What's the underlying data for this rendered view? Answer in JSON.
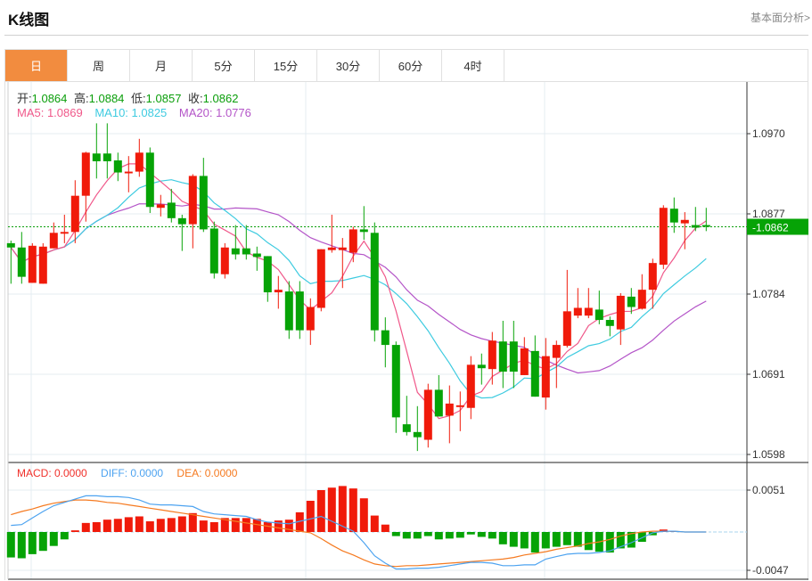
{
  "header": {
    "title": "K线图",
    "fundamental_link": "基本面分析>"
  },
  "tabs": [
    {
      "label": "日",
      "active": true
    },
    {
      "label": "周"
    },
    {
      "label": "月"
    },
    {
      "label": "5分"
    },
    {
      "label": "15分"
    },
    {
      "label": "30分"
    },
    {
      "label": "60分"
    },
    {
      "label": "4时"
    }
  ],
  "ohlc_legend": {
    "open_label": "开:",
    "open": "1.0864",
    "high_label": "高:",
    "high": "1.0884",
    "low_label": "低:",
    "low": "1.0857",
    "close_label": "收:",
    "close": "1.0862"
  },
  "ma_legend": {
    "ma5": "MA5: 1.0869",
    "ma10": "MA10: 1.0825",
    "ma20": "MA20: 1.0776"
  },
  "macd_legend": {
    "macd": "MACD: 0.0000",
    "diff": "DIFF: 0.0000",
    "dea": "DEA: 0.0000"
  },
  "colors": {
    "up": "#f01a0a",
    "down": "#06a306",
    "ma5": "#f0588a",
    "ma10": "#3ecbe0",
    "ma20": "#b455c8",
    "diff": "#4da3f0",
    "dea": "#f57a20",
    "accent": "#f28c3f"
  },
  "chart_data": {
    "type": "candlestick",
    "y_ticks": [
      "1.0970",
      "1.0877",
      "1.0784",
      "1.0691",
      "1.0598"
    ],
    "last_price": "1.0862",
    "macd_ticks": [
      "0.0051",
      "-0.0047"
    ],
    "candles": [
      [
        1.0843,
        1.0846,
        1.0796,
        1.0838
      ],
      [
        1.0838,
        1.0856,
        1.0796,
        1.0804
      ],
      [
        1.0797,
        1.0843,
        1.0797,
        1.084
      ],
      [
        1.0796,
        1.0843,
        1.0796,
        1.0839
      ],
      [
        1.0837,
        1.0867,
        1.0837,
        1.0855
      ],
      [
        1.0854,
        1.0876,
        1.0843,
        1.0856
      ],
      [
        1.0856,
        1.0916,
        1.0843,
        1.0898
      ],
      [
        1.0898,
        1.0949,
        1.0868,
        1.0948
      ],
      [
        1.0947,
        1.0982,
        1.0918,
        1.0938
      ],
      [
        1.0947,
        1.0982,
        1.0918,
        1.0938
      ],
      [
        1.0939,
        1.0948,
        1.0915,
        1.0925
      ],
      [
        1.0924,
        1.0944,
        1.0902,
        1.0926
      ],
      [
        1.0926,
        1.0964,
        1.092,
        1.0948
      ],
      [
        1.0948,
        1.0954,
        1.0878,
        1.0885
      ],
      [
        1.0884,
        1.0899,
        1.0874,
        1.0888
      ],
      [
        1.089,
        1.0906,
        1.0867,
        1.0872
      ],
      [
        1.0872,
        1.0876,
        1.0834,
        1.0865
      ],
      [
        1.0865,
        1.0923,
        1.0837,
        1.0921
      ],
      [
        1.0921,
        1.0942,
        1.0856,
        1.0859
      ],
      [
        1.086,
        1.0868,
        1.0802,
        1.0808
      ],
      [
        1.0807,
        1.0843,
        1.0802,
        1.0838
      ],
      [
        1.0837,
        1.0864,
        1.0824,
        1.083
      ],
      [
        1.0837,
        1.0864,
        1.0824,
        1.083
      ],
      [
        1.0831,
        1.0839,
        1.0811,
        1.0827
      ],
      [
        1.0828,
        1.0828,
        1.0775,
        1.0786
      ],
      [
        1.0786,
        1.0805,
        1.0767,
        1.0789
      ],
      [
        1.0787,
        1.0799,
        1.0732,
        1.0742
      ],
      [
        1.0787,
        1.0799,
        1.0732,
        1.0742
      ],
      [
        1.0742,
        1.0779,
        1.0725,
        1.0769
      ],
      [
        1.0768,
        1.0836,
        1.0764,
        1.0836
      ],
      [
        1.0835,
        1.0876,
        1.0832,
        1.0838
      ],
      [
        1.0835,
        1.0849,
        1.0791,
        1.0838
      ],
      [
        1.0832,
        1.0862,
        1.0821,
        1.0859
      ],
      [
        1.0859,
        1.0886,
        1.0847,
        1.0856
      ],
      [
        1.0855,
        1.0867,
        1.0729,
        1.0742
      ],
      [
        1.0742,
        1.0757,
        1.0699,
        1.0725
      ],
      [
        1.0725,
        1.0729,
        1.0623,
        1.0641
      ],
      [
        1.0633,
        1.0666,
        1.062,
        1.0624
      ],
      [
        1.0624,
        1.0654,
        1.0602,
        1.0618
      ],
      [
        1.0615,
        1.068,
        1.0606,
        1.0673
      ],
      [
        1.0673,
        1.069,
        1.0642,
        1.0642
      ],
      [
        1.0643,
        1.0678,
        1.0611,
        1.0657
      ],
      [
        1.0653,
        1.0671,
        1.0625,
        1.0655
      ],
      [
        1.0652,
        1.0712,
        1.0639,
        1.0702
      ],
      [
        1.0702,
        1.0715,
        1.0679,
        1.0698
      ],
      [
        1.0697,
        1.074,
        1.0679,
        1.073
      ],
      [
        1.0729,
        1.0753,
        1.0675,
        1.0694
      ],
      [
        1.0729,
        1.0753,
        1.0675,
        1.0694
      ],
      [
        1.069,
        1.0734,
        1.069,
        1.0721
      ],
      [
        1.0718,
        1.0736,
        1.0665,
        1.0665
      ],
      [
        1.0664,
        1.0733,
        1.065,
        1.0712
      ],
      [
        1.071,
        1.073,
        1.0675,
        1.0725
      ],
      [
        1.0724,
        1.0812,
        1.0722,
        1.0764
      ],
      [
        1.0759,
        1.0791,
        1.0756,
        1.0768
      ],
      [
        1.0759,
        1.0791,
        1.0756,
        1.0768
      ],
      [
        1.0766,
        1.0788,
        1.0749,
        1.0754
      ],
      [
        1.0754,
        1.0758,
        1.0735,
        1.0747
      ],
      [
        1.0743,
        1.0785,
        1.0725,
        1.0782
      ],
      [
        1.0781,
        1.0791,
        1.0761,
        1.0769
      ],
      [
        1.0767,
        1.0807,
        1.0766,
        1.0789
      ],
      [
        1.0789,
        1.0825,
        1.0767,
        1.082
      ],
      [
        1.0818,
        1.0887,
        1.0813,
        1.0884
      ],
      [
        1.0883,
        1.0896,
        1.0855,
        1.0867
      ],
      [
        1.0866,
        1.0879,
        1.0836,
        1.087
      ],
      [
        1.0864,
        1.0885,
        1.0857,
        1.0861
      ],
      [
        1.0864,
        1.0884,
        1.0857,
        1.0862
      ]
    ],
    "macd_hist": [
      -0.0031,
      -0.0032,
      -0.0027,
      -0.0023,
      -0.0017,
      -0.0009,
      0.0002,
      0.0011,
      0.0012,
      0.0015,
      0.0016,
      0.0018,
      0.0019,
      0.0013,
      0.0016,
      0.0017,
      0.0019,
      0.0023,
      0.0014,
      0.0012,
      0.0017,
      0.0017,
      0.0017,
      0.0016,
      0.0012,
      0.0014,
      0.0015,
      0.0024,
      0.0038,
      0.0051,
      0.0054,
      0.0056,
      0.0053,
      0.0041,
      0.002,
      0.0009,
      -0.0005,
      -0.0008,
      -0.0008,
      -0.0005,
      -0.0009,
      -0.0008,
      -0.0007,
      -0.0003,
      -0.0006,
      -0.0008,
      -0.0015,
      -0.0018,
      -0.002,
      -0.0025,
      -0.002,
      -0.0018,
      -0.0016,
      -0.0018,
      -0.0022,
      -0.0024,
      -0.0025,
      -0.002,
      -0.0019,
      -0.0012,
      -0.0004,
      0.0003,
      0.0001,
      0,
      0,
      0
    ],
    "diff": [
      0.0008,
      0.0009,
      0.0017,
      0.0025,
      0.0032,
      0.0036,
      0.004,
      0.0044,
      0.0044,
      0.0043,
      0.0043,
      0.0042,
      0.0039,
      0.0034,
      0.0033,
      0.0033,
      0.0032,
      0.0031,
      0.0025,
      0.0022,
      0.0021,
      0.002,
      0.0019,
      0.0015,
      0.0012,
      0.0011,
      0.001,
      0.0013,
      0.0016,
      0.0019,
      0.0013,
      0.0007,
      0.0001,
      -0.0013,
      -0.0029,
      -0.0038,
      -0.0045,
      -0.0045,
      -0.0044,
      -0.0044,
      -0.0043,
      -0.0041,
      -0.0039,
      -0.0037,
      -0.0037,
      -0.0038,
      -0.0041,
      -0.0041,
      -0.004,
      -0.004,
      -0.0033,
      -0.003,
      -0.0027,
      -0.0026,
      -0.0026,
      -0.0025,
      -0.0023,
      -0.0018,
      -0.0013,
      -0.0007,
      -0.0001,
      0.0001,
      0.0001,
      0,
      0,
      0
    ],
    "dea": [
      0.0021,
      0.0025,
      0.0028,
      0.0032,
      0.0035,
      0.0037,
      0.0039,
      0.0039,
      0.0038,
      0.0036,
      0.0035,
      0.0033,
      0.0031,
      0.0029,
      0.0027,
      0.0025,
      0.0023,
      0.0021,
      0.0019,
      0.0017,
      0.0015,
      0.0013,
      0.0011,
      0.0009,
      0.0007,
      0.0005,
      0.0003,
      0.0001,
      -0.0001,
      -0.0008,
      -0.0016,
      -0.0023,
      -0.0028,
      -0.0034,
      -0.0039,
      -0.0041,
      -0.0042,
      -0.0041,
      -0.0041,
      -0.004,
      -0.0039,
      -0.0038,
      -0.0037,
      -0.0036,
      -0.0035,
      -0.0034,
      -0.0033,
      -0.0031,
      -0.0028,
      -0.0026,
      -0.0024,
      -0.0021,
      -0.0019,
      -0.0017,
      -0.0014,
      -0.0012,
      -0.0009,
      -0.0005,
      -0.0002,
      0,
      0.0001,
      0.0001,
      0.0001,
      0,
      0,
      0
    ]
  }
}
